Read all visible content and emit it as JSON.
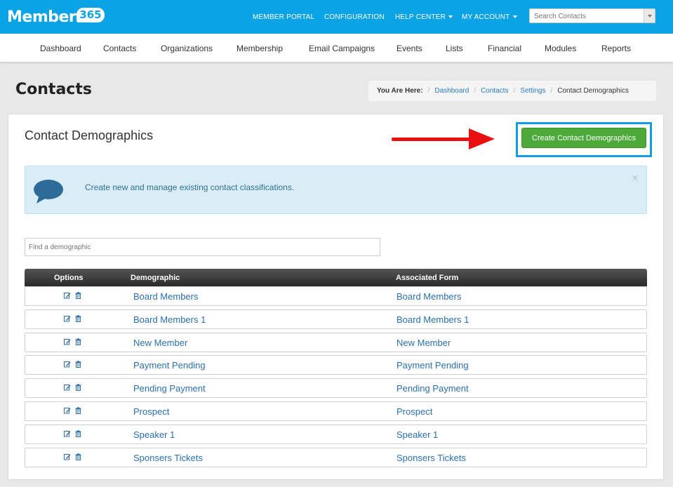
{
  "topbar": {
    "logo_text": "Member",
    "logo_badge": "365",
    "nav": [
      {
        "label": "MEMBER PORTAL",
        "dropdown": false
      },
      {
        "label": "CONFIGURATION",
        "dropdown": false
      },
      {
        "label": "HELP CENTER",
        "dropdown": true
      },
      {
        "label": "MY ACCOUNT",
        "dropdown": true
      }
    ],
    "search_placeholder": "Search Contacts"
  },
  "subnav": [
    "Dashboard",
    "Contacts",
    "Organizations",
    "Membership",
    "Email Campaigns",
    "Events",
    "Lists",
    "Financial",
    "Modules",
    "Reports"
  ],
  "page": {
    "title": "Contacts",
    "breadcrumb": {
      "label": "You Are Here:",
      "links": [
        "Dashboard",
        "Contacts",
        "Settings"
      ],
      "current": "Contact Demographics"
    }
  },
  "panel": {
    "title": "Contact Demographics",
    "create_button": "Create Contact Demographics",
    "info_text": "Create new and manage existing contact classifications.",
    "info_close": "×",
    "find_placeholder": "Find a demographic"
  },
  "table": {
    "headers": [
      "Options",
      "Demographic",
      "Associated Form"
    ],
    "rows": [
      {
        "demographic": "Board Members",
        "form": "Board Members"
      },
      {
        "demographic": "Board Members 1",
        "form": "Board Members 1"
      },
      {
        "demographic": "New Member",
        "form": "New Member"
      },
      {
        "demographic": "Payment Pending",
        "form": "Payment Pending"
      },
      {
        "demographic": "Pending Payment",
        "form": "Pending Payment"
      },
      {
        "demographic": "Prospect",
        "form": "Prospect"
      },
      {
        "demographic": "Speaker 1",
        "form": "Speaker 1"
      },
      {
        "demographic": "Sponsers Tickets",
        "form": "Sponsers Tickets"
      }
    ]
  },
  "colors": {
    "topbar": "#0aa3e6",
    "create_button": "#4caa3a",
    "highlight_box": "#119ee7",
    "arrow": "#e81010",
    "info_bg": "#d9edf7",
    "link": "#2a6fae"
  },
  "icons": [
    "speech-bubble-icon",
    "edit-icon",
    "trash-icon",
    "chevron-down-icon"
  ]
}
